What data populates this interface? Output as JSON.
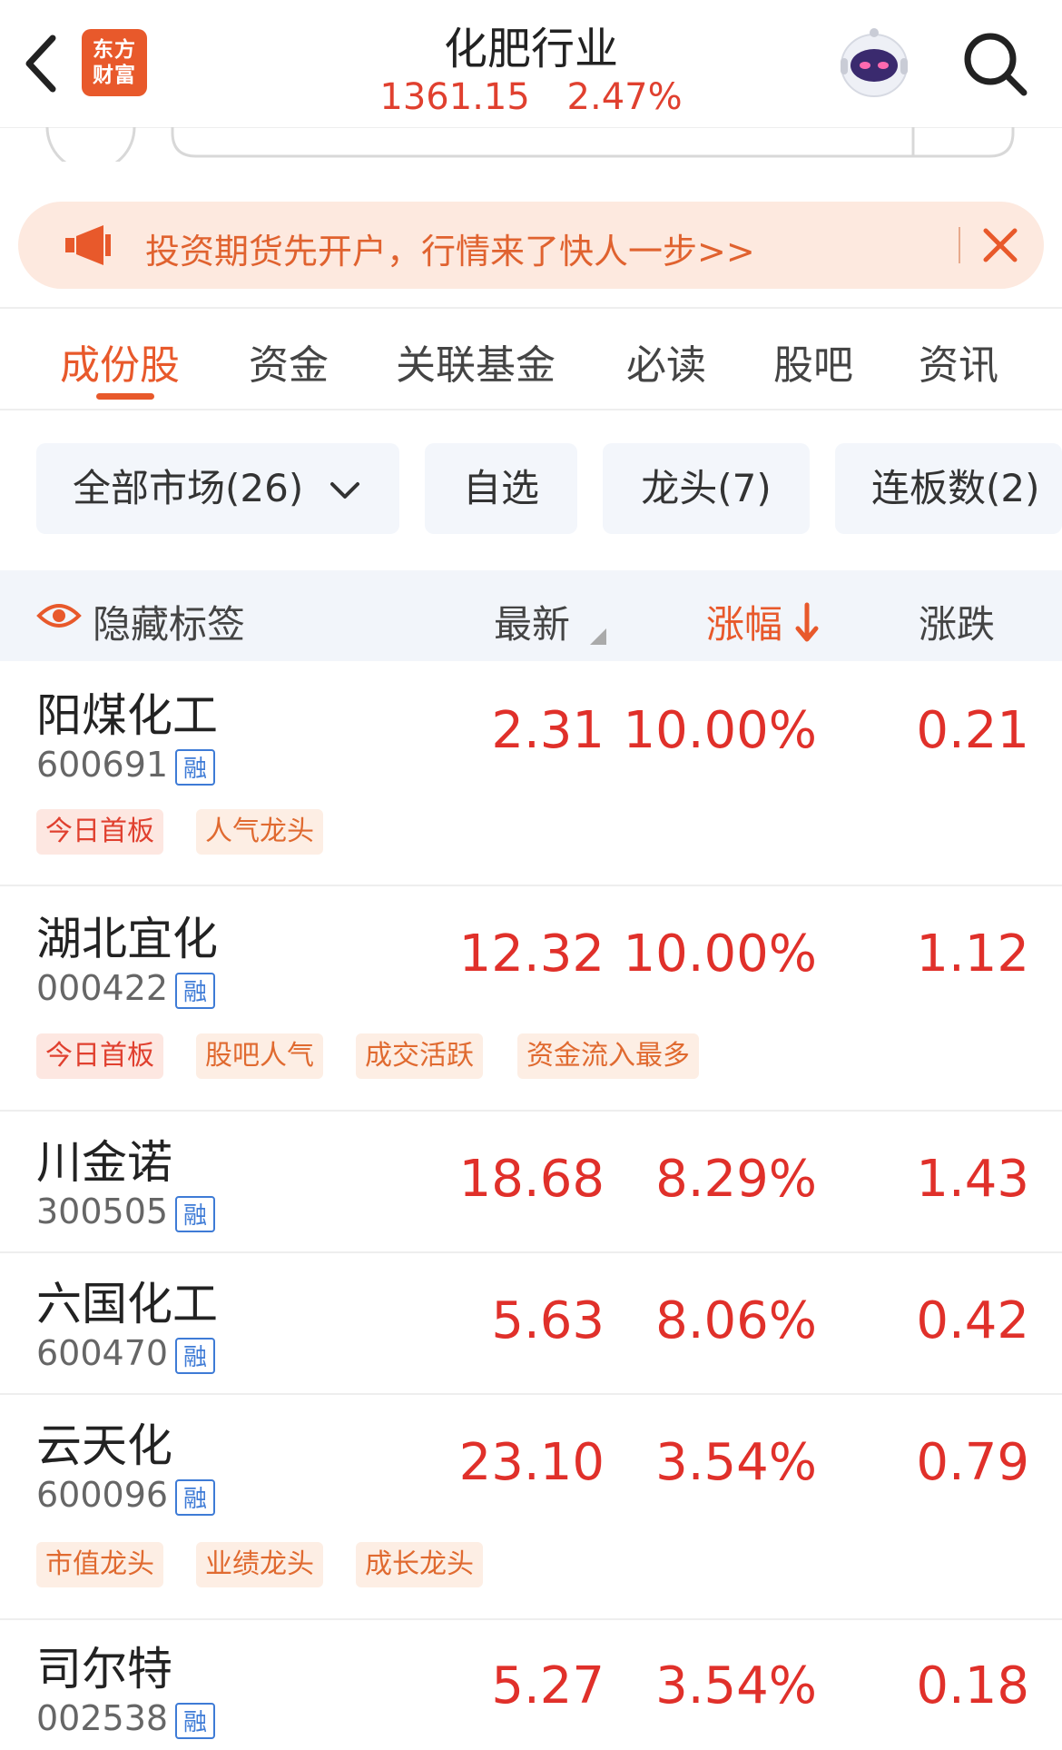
{
  "header": {
    "title": "化肥行业",
    "index_value": "1361.15",
    "index_change": "2.47%",
    "logo_line1": "东方",
    "logo_line2": "财富"
  },
  "banner": {
    "text": "投资期货先开户，行情来了快人一步>>"
  },
  "tabs": [
    {
      "label": "成份股"
    },
    {
      "label": "资金"
    },
    {
      "label": "关联基金"
    },
    {
      "label": "必读"
    },
    {
      "label": "股吧"
    },
    {
      "label": "资讯"
    }
  ],
  "filters": [
    {
      "label": "全部市场(26)"
    },
    {
      "label": "自选"
    },
    {
      "label": "龙头(7)"
    },
    {
      "label": "连板数(2)"
    }
  ],
  "table": {
    "hide_tags_label": "隐藏标签",
    "columns": {
      "latest": "最新",
      "change_pct": "涨幅",
      "change": "涨跌"
    },
    "margin_tag": "融",
    "rows": [
      {
        "name": "阳煤化工",
        "code": "600691",
        "price": "2.31",
        "pct": "10.00%",
        "chg": "0.21",
        "tags": [
          "今日首板",
          "人气龙头"
        ]
      },
      {
        "name": "湖北宜化",
        "code": "000422",
        "price": "12.32",
        "pct": "10.00%",
        "chg": "1.12",
        "tags": [
          "今日首板",
          "股吧人气",
          "成交活跃",
          "资金流入最多"
        ]
      },
      {
        "name": "川金诺",
        "code": "300505",
        "price": "18.68",
        "pct": "8.29%",
        "chg": "1.43",
        "tags": []
      },
      {
        "name": "六国化工",
        "code": "600470",
        "price": "5.63",
        "pct": "8.06%",
        "chg": "0.42",
        "tags": []
      },
      {
        "name": "云天化",
        "code": "600096",
        "price": "23.10",
        "pct": "3.54%",
        "chg": "0.79",
        "tags": [
          "市值龙头",
          "业绩龙头",
          "成长龙头"
        ]
      },
      {
        "name": "司尔特",
        "code": "002538",
        "price": "5.27",
        "pct": "3.54%",
        "chg": "0.18",
        "tags": []
      }
    ]
  },
  "colors": {
    "accent": "#e8592b",
    "up_red": "#e0302a",
    "margin_blue": "#3e7bd6"
  }
}
